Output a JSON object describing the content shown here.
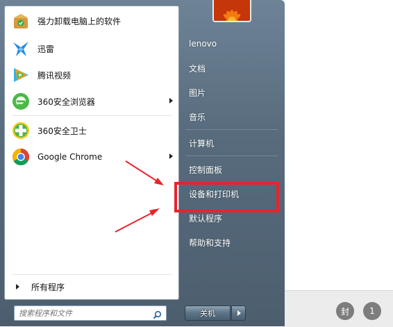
{
  "start_menu": {
    "programs": [
      {
        "label": "强力卸载电脑上的软件",
        "icon": "uninstaller-box-icon",
        "submenu": false
      },
      {
        "label": "迅雷",
        "icon": "xunlei-bird-icon",
        "submenu": false
      },
      {
        "label": "腾讯视频",
        "icon": "tencent-video-icon",
        "submenu": false
      },
      {
        "label": "360安全浏览器",
        "icon": "360-browser-icon",
        "submenu": true
      },
      {
        "label": "360安全卫士",
        "icon": "360-safeguard-icon",
        "submenu": false
      },
      {
        "label": "Google Chrome",
        "icon": "chrome-icon",
        "submenu": true
      }
    ],
    "all_programs_label": "所有程序",
    "search": {
      "placeholder": "搜索程序和文件",
      "value": ""
    },
    "right_items": [
      {
        "label": "lenovo"
      },
      {
        "label": "文档"
      },
      {
        "label": "图片"
      },
      {
        "label": "音乐"
      },
      {
        "label": "计算机"
      },
      {
        "label": "控制面板"
      },
      {
        "label": "设备和打印机",
        "highlighted": true
      },
      {
        "label": "默认程序"
      },
      {
        "label": "帮助和支持"
      }
    ],
    "shutdown_label": "关机"
  },
  "background_window": {
    "buttons": [
      "封",
      "1"
    ]
  },
  "colors": {
    "highlight_border": "#e8232a",
    "annotation_arrow": "#e8232a",
    "right_pane": "#586c7e"
  }
}
